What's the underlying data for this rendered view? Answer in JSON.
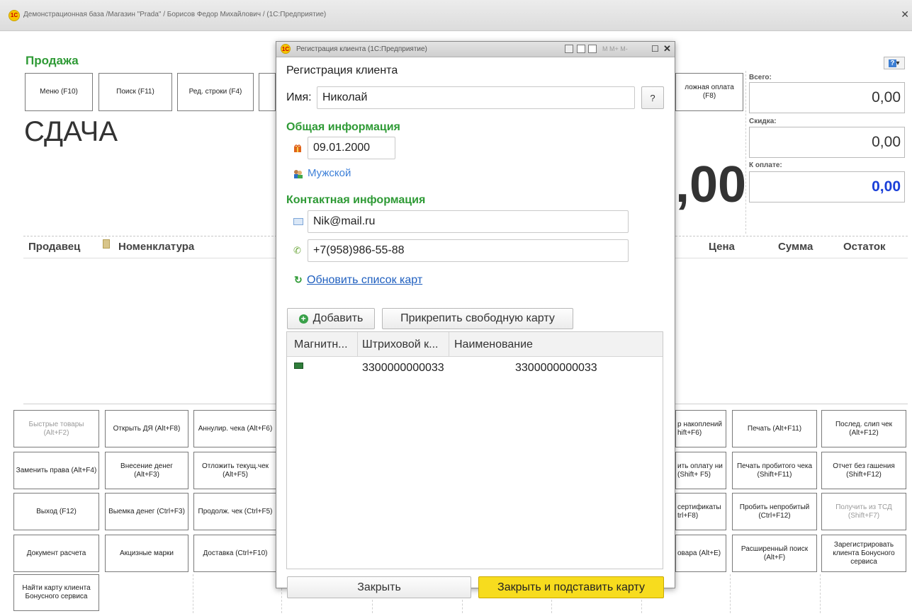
{
  "window": {
    "title": "Демонстрационная база /Магазин \"Prada\" / Борисов Федор Михайлович /  (1С:Предприятие)",
    "logo": "1С"
  },
  "main": {
    "title": "Продажа",
    "top_buttons": [
      "Меню (F10)",
      "Поиск (F11)",
      "Ред. строки (F4)",
      "ложная оплата (F8)"
    ],
    "change_label": "СДАЧА",
    "change_value": ",00",
    "totals": {
      "total_label": "Всего:",
      "total_value": "0,00",
      "discount_label": "Скидка:",
      "discount_value": "0,00",
      "pay_label": "К оплате:",
      "pay_value": "0,00"
    },
    "table_headers": [
      "Продавец",
      "Номенклатура",
      "Цена",
      "Сумма",
      "Остаток"
    ],
    "left_buttons": [
      [
        "Быстрые товары (Alt+F2)",
        "Открыть ДЯ (Alt+F8)",
        "Аннулир. чека (Alt+F6)"
      ],
      [
        "Заменить права (Alt+F4)",
        "Внесение денег (Alt+F3)",
        "Отложить текущ.чек (Alt+F5)"
      ],
      [
        "Выход (F12)",
        "Выемка денег (Ctrl+F3)",
        "Продолж. чек (Ctrl+F5)"
      ],
      [
        "Документ расчета",
        "Акцизные марки",
        "Доставка (Ctrl+F10)"
      ]
    ],
    "extra_button": "Найти карту клиента Бонусного сервиса",
    "right_partial_buttons": [
      "р накоплений hift+F6)",
      "ить оплату ни (Shift+ F5)",
      "сертификаты trl+F8)",
      "овара (Alt+E)"
    ],
    "right_buttons": [
      [
        "Печать (Alt+F11)",
        "Послед. слип чек (Alt+F12)"
      ],
      [
        "Печать пробитого чека (Shift+F11)",
        "Отчет без гашения (Shift+F12)"
      ],
      [
        "Пробить непробитый (Ctrl+F12)",
        "Получить из ТСД (Shift+F7)"
      ],
      [
        "Расширенный поиск (Alt+F)",
        "Зарегистрировать клиента Бонусного сервиса"
      ]
    ],
    "help_button": "?"
  },
  "modal": {
    "window_title": "Регистрация клиента  (1С:Предприятие)",
    "toolbar_text": "M  M+  M-",
    "heading": "Регистрация клиента",
    "name_label": "Имя:",
    "name_value": "Николай",
    "help_label": "?",
    "general_section": "Общая информация",
    "birthdate": "09.01.2000",
    "gender": "Мужской",
    "contact_section": "Контактная информация",
    "email": "Nik@mail.ru",
    "phone": "+7(958)986-55-88",
    "refresh_link": "Обновить список карт",
    "add_button": "Добавить",
    "attach_button": "Прикрепить свободную карту",
    "cards_table": {
      "columns": [
        "Магнитн...",
        "Штриховой к...",
        "Наименование"
      ],
      "rows": [
        [
          "",
          "3300000000033",
          "3300000000033"
        ]
      ]
    },
    "close_button": "Закрыть",
    "close_apply_button": "Закрыть и подставить карту"
  },
  "colors": {
    "accent_green": "#2e9a35",
    "link_blue": "#1f5fbf",
    "primary_yellow": "#f7dc1e",
    "pay_blue": "#1a3fd8"
  }
}
